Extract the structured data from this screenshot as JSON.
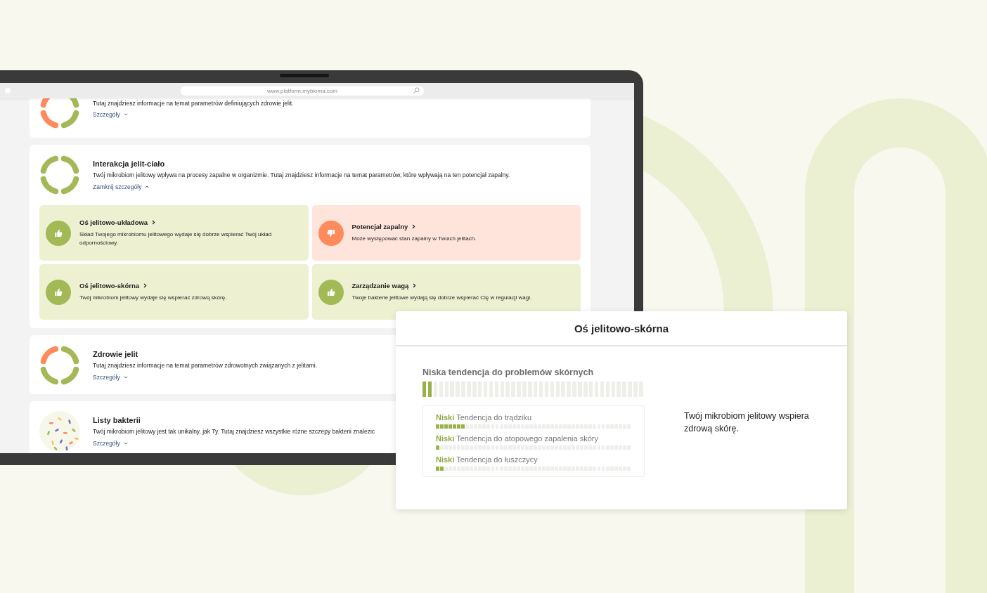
{
  "browser": {
    "url": "www.platform.mybioma.com"
  },
  "sections": [
    {
      "kind": "ring",
      "ring": [
        {
          "color": "#a3b956"
        },
        {
          "color": "#a3b956"
        },
        {
          "color": "#ff8a5c"
        },
        {
          "color": "#ff8a5c"
        }
      ],
      "description": "Tutaj znajdziesz informacje na temat parametrów definiujących zdrowie jelit.",
      "toggle": {
        "label": "Szczegóły",
        "expanded": false
      }
    },
    {
      "kind": "ring",
      "ring": [
        {
          "color": "#a3b956"
        },
        {
          "color": "#a3b956"
        },
        {
          "color": "#a3b956"
        },
        {
          "color": "#a3b956"
        }
      ],
      "title": "Interakcja jelit-ciało",
      "description": "Twój mikrobiom jelitowy wpływa na procesy zapalne w organizmie. Tutaj znajdziesz informacje na temat parametrów, które wpływają na ten potencjał zapalny.",
      "toggle": {
        "label": "Zamknij szczegóły",
        "expanded": true
      },
      "tiles": [
        {
          "kind": "good",
          "title": "Oś jelitowo-układowa",
          "text": "Skład Twojego mikrobiomu jelitowego wydaje się dobrze wspierać Twój układ odpornościowy."
        },
        {
          "kind": "bad",
          "title": "Potencjał zapalny",
          "text": "Może występować stan zapalny w Twoich jelitach."
        },
        {
          "kind": "good",
          "title": "Oś jelitowo-skórna",
          "text": "Twój mikrobiom jelitowy wydaje się wspierać zdrową skórę."
        },
        {
          "kind": "good",
          "title": "Zarządzanie wagą",
          "text": "Twoje bakterie jelitowe wydają się dobrze wspierać Cię w regulacji wagi."
        }
      ]
    },
    {
      "kind": "ring",
      "ring": [
        {
          "color": "#a3b956"
        },
        {
          "color": "#a3b956"
        },
        {
          "color": "#a3b956"
        },
        {
          "color": "#ff8a5c"
        }
      ],
      "title": "Zdrowie jelit",
      "description": "Tutaj znajdziesz informacje na temat parametrów zdrowotnych związanych z jelitami.",
      "toggle": {
        "label": "Szczegóły",
        "expanded": false
      }
    },
    {
      "kind": "bacteria",
      "title": "Listy bakterii",
      "description": "Twój mikrobiom jelitowy jest tak unikalny, jak Ty. Tutaj znajdziesz wszystkie różne szczepy bakterii znalezic",
      "toggle": {
        "label": "Szczegóły",
        "expanded": false
      }
    }
  ],
  "popup": {
    "title": "Oś jelitowo-skórna",
    "meter": {
      "label": "Niska tendencja do problemów skórnych",
      "level": 0.05
    },
    "items": [
      {
        "grade": "Niski",
        "label": "Tendencja do trądziku",
        "level": 0.15
      },
      {
        "grade": "Niski",
        "label": "Tendencja do atopowego zapalenia skóry",
        "level": 0.02
      },
      {
        "grade": "Niski",
        "label": "Tendencja do łuszczycy",
        "level": 0.04
      }
    ],
    "summary": "Twój mikrobiom jelitowy wspiera zdrową skórę."
  }
}
